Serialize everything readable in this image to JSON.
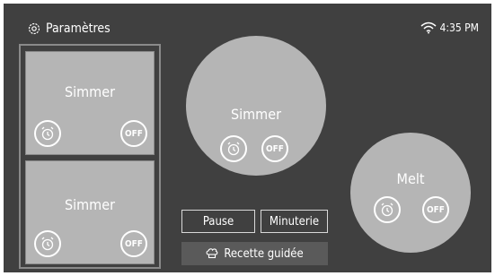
{
  "header": {
    "title": "Paramètres"
  },
  "status": {
    "time": "4:35 PM"
  },
  "zones": {
    "top_left": {
      "label": "Simmer",
      "off": "OFF"
    },
    "bottom_left": {
      "label": "Simmer",
      "off": "OFF"
    },
    "center": {
      "label": "Simmer",
      "off": "OFF"
    },
    "right": {
      "label": "Melt",
      "off": "OFF"
    }
  },
  "controls": {
    "pause": "Pause",
    "timer": "Minuterie",
    "guided_recipe": "Recette guidée"
  },
  "icons": {
    "settings": "gear-icon",
    "wifi": "wifi-icon",
    "timer": "alarm-clock-icon",
    "recipe": "chef-hat-icon"
  }
}
